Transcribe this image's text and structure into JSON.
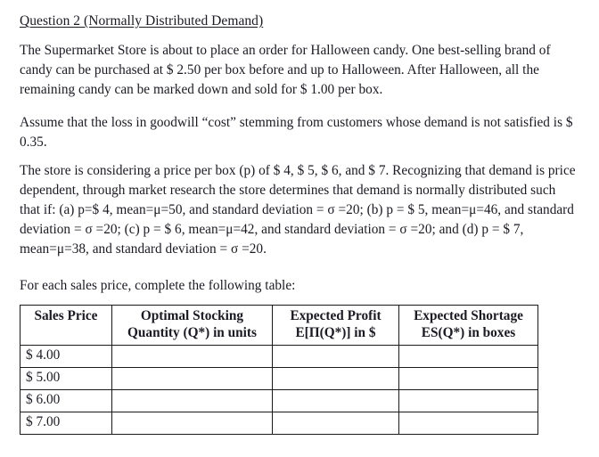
{
  "document": {
    "heading": "Question 2 (Normally Distributed Demand)",
    "paragraphs": {
      "intro": "The Supermarket Store is about to place an order for Halloween candy.  One best-selling brand of candy can be purchased at $ 2.50 per box before and up to Halloween.  After Halloween, all the remaining candy can be marked down and sold for $ 1.00 per box.",
      "goodwill": "Assume that the loss in goodwill “cost” stemming from customers whose demand is not satisfied is $ 0.35.",
      "pricing": "The store is considering a price per box (p) of $ 4, $ 5, $ 6, and $ 7.  Recognizing that demand is price dependent, through market research the store determines that demand is normally distributed such that if: (a) p=$ 4, mean=μ=50, and standard deviation = σ =20; (b) p = $ 5, mean=μ=46, and standard deviation = σ =20; (c) p = $ 6, mean=μ=42, and standard deviation = σ =20; and (d) p = $ 7, mean=μ=38, and standard deviation = σ =20.",
      "instruction": "For each sales price, complete the following table:"
    }
  },
  "table": {
    "headers": [
      {
        "line1": "Sales Price",
        "line2": ""
      },
      {
        "line1": "Optimal Stocking",
        "line2": "Quantity (Q*) in units"
      },
      {
        "line1": "Expected Profit",
        "line2": "E[Π(Q*)] in $"
      },
      {
        "line1": "Expected Shortage",
        "line2": "ES(Q*)  in boxes"
      }
    ],
    "rows": [
      {
        "price": "$ 4.00",
        "quantity": "",
        "profit": "",
        "shortage": ""
      },
      {
        "price": "$ 5.00",
        "quantity": "",
        "profit": "",
        "shortage": ""
      },
      {
        "price": "$ 6.00",
        "quantity": "",
        "profit": "",
        "shortage": ""
      },
      {
        "price": "$ 7.00",
        "quantity": "",
        "profit": "",
        "shortage": ""
      }
    ]
  }
}
